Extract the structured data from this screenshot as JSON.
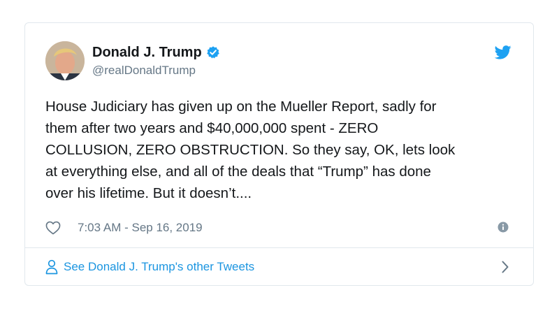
{
  "user": {
    "display_name": "Donald J. Trump",
    "handle": "@realDonaldTrump",
    "verified": true
  },
  "tweet": {
    "text": "House Judiciary has given up on the Mueller Report, sadly for\nthem after two years and $40,000,000 spent - ZERO\nCOLLUSION, ZERO OBSTRUCTION. So they say, OK, lets look\nat everything else, and all of the deals that “Trump” has done\nover his lifetime. But it doesn’t....",
    "timestamp": "7:03 AM - Sep 16, 2019"
  },
  "footer": {
    "label": "See Donald J. Trump's other Tweets"
  },
  "icons": {
    "like": "heart-icon",
    "info": "info-icon",
    "brand": "twitter-bird-icon",
    "verified": "verified-badge-icon",
    "profile": "user-icon",
    "more": "chevron-right-icon"
  },
  "colors": {
    "brand_blue": "#1da1f2",
    "link_blue": "#1b95e0",
    "text": "#14171a",
    "secondary_text": "#657786",
    "border": "#e1e8ed"
  }
}
